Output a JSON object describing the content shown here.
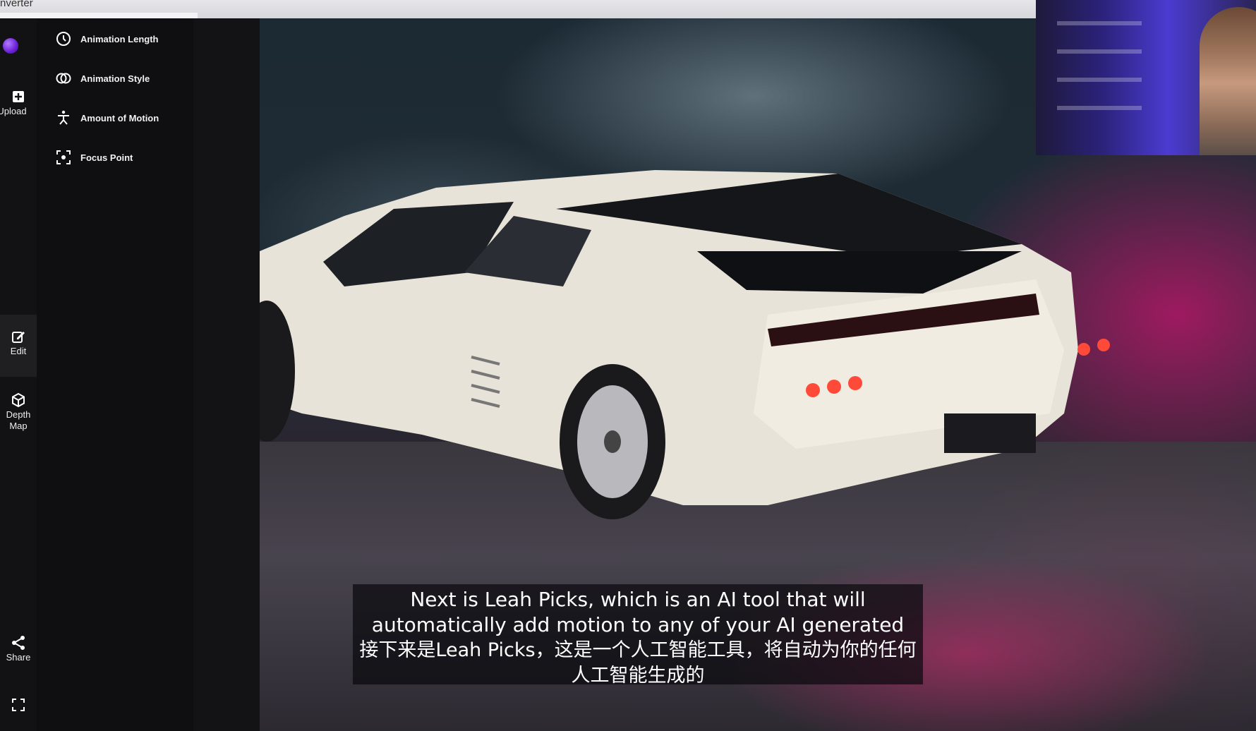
{
  "window": {
    "title": "nverter"
  },
  "rail": {
    "items": [
      {
        "label": "Upload",
        "icon": "plus-square-icon"
      },
      {
        "label": "Edit",
        "icon": "edit-icon"
      },
      {
        "label": "Depth Map",
        "icon": "cube-icon"
      },
      {
        "label": "Share",
        "icon": "share-icon"
      },
      {
        "label": "",
        "icon": "fullscreen-icon"
      }
    ]
  },
  "menu": {
    "items": [
      {
        "label": "Animation Length",
        "icon": "clock-icon"
      },
      {
        "label": "Animation Style",
        "icon": "interlocked-circles-icon"
      },
      {
        "label": "Amount of Motion",
        "icon": "motion-figure-icon"
      },
      {
        "label": "Focus Point",
        "icon": "focus-target-icon"
      }
    ]
  },
  "subtitle": {
    "english": "Next is Leah Picks, which is an AI tool that will automatically add motion to any of your AI generated",
    "chinese": "接下来是Leah Picks，这是一个人工智能工具，将自动为你的任何人工智能生成的"
  },
  "colors": {
    "accent": "#7b2ff0",
    "subtitle_bg": "#0a0a0e"
  }
}
